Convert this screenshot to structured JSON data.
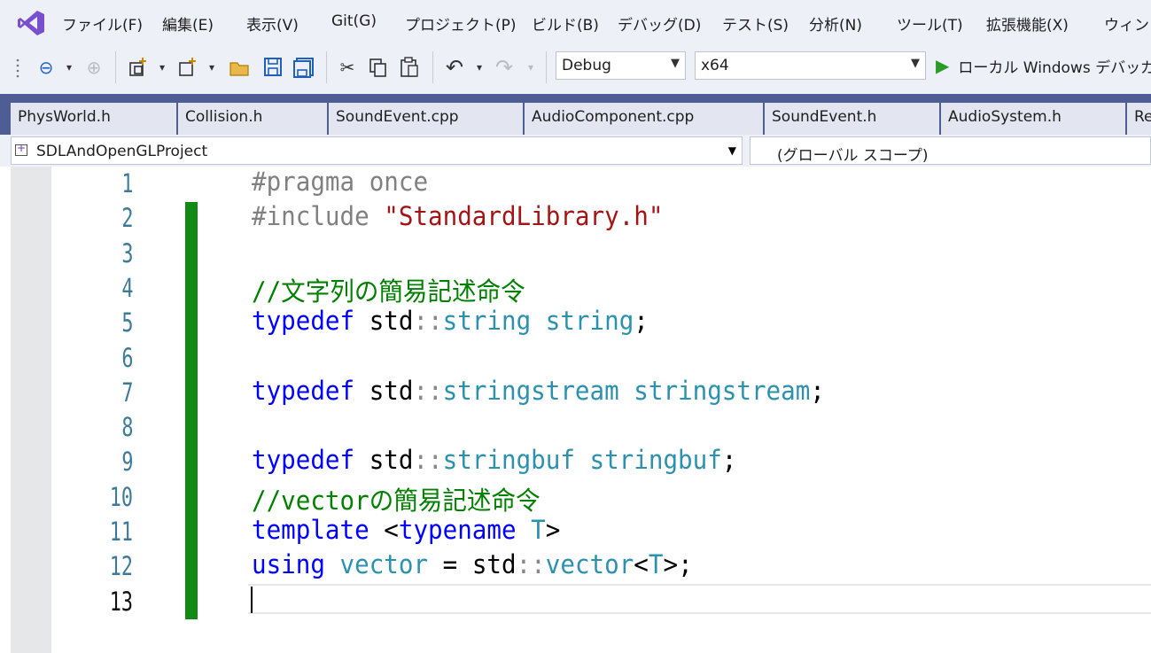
{
  "menu": {
    "items": [
      "ファイル(F)",
      "編集(E)",
      "表示(V)",
      "Git(G)",
      "プロジェクト(P)",
      "ビルド(B)",
      "デバッグ(D)",
      "テスト(S)",
      "分析(N)",
      "ツール(T)",
      "拡張機能(X)",
      "ウィンドウ"
    ]
  },
  "toolbar": {
    "configuration": "Debug",
    "platform": "x64",
    "run_label": "ローカル Windows デバッガー"
  },
  "tabs": [
    "PhysWorld.h",
    "Collision.h",
    "SoundEvent.cpp",
    "AudioComponent.cpp",
    "SoundEvent.h",
    "AudioSystem.h",
    "Re"
  ],
  "navbar": {
    "project": "SDLAndOpenGLProject",
    "scope": "(グローバル スコープ)"
  },
  "editor": {
    "line_numbers": [
      "1",
      "2",
      "3",
      "4",
      "5",
      "6",
      "7",
      "8",
      "9",
      "10",
      "11",
      "12",
      "13"
    ],
    "active_line": 13,
    "lines": [
      [
        [
          "pp",
          "#pragma once"
        ]
      ],
      [
        [
          "pp",
          "#include "
        ],
        [
          "s",
          "\"StandardLibrary.h\""
        ]
      ],
      [],
      [
        [
          "c",
          "//文字列の簡易記述命令"
        ]
      ],
      [
        [
          "k",
          "typedef"
        ],
        [
          "d",
          " std"
        ],
        [
          "op",
          "::"
        ],
        [
          "t",
          "string"
        ],
        [
          "d",
          " "
        ],
        [
          "t",
          "string"
        ],
        [
          "d",
          ";"
        ]
      ],
      [],
      [
        [
          "k",
          "typedef"
        ],
        [
          "d",
          " std"
        ],
        [
          "op",
          "::"
        ],
        [
          "t",
          "stringstream"
        ],
        [
          "d",
          " "
        ],
        [
          "t",
          "stringstream"
        ],
        [
          "d",
          ";"
        ]
      ],
      [],
      [
        [
          "k",
          "typedef"
        ],
        [
          "d",
          " std"
        ],
        [
          "op",
          "::"
        ],
        [
          "t",
          "stringbuf"
        ],
        [
          "d",
          " "
        ],
        [
          "t",
          "stringbuf"
        ],
        [
          "d",
          ";"
        ]
      ],
      [
        [
          "c",
          "//vectorの簡易記述命令"
        ]
      ],
      [
        [
          "k",
          "template"
        ],
        [
          "d",
          " <"
        ],
        [
          "k",
          "typename"
        ],
        [
          "d",
          " "
        ],
        [
          "t",
          "T"
        ],
        [
          "d",
          ">"
        ]
      ],
      [
        [
          "k",
          "using"
        ],
        [
          "d",
          " "
        ],
        [
          "t",
          "vector"
        ],
        [
          "d",
          " = std"
        ],
        [
          "op",
          "::"
        ],
        [
          "t",
          "vector"
        ],
        [
          "d",
          "<"
        ],
        [
          "t",
          "T"
        ],
        [
          "d",
          ">;"
        ]
      ],
      []
    ]
  }
}
